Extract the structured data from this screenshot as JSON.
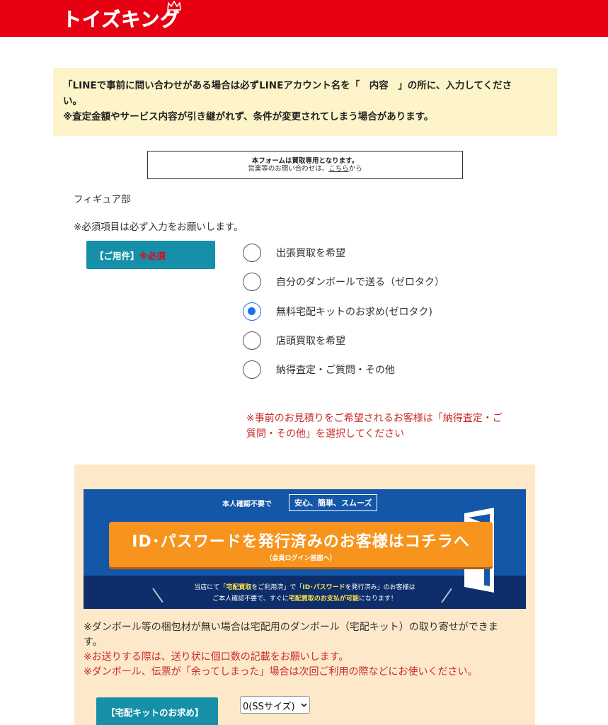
{
  "header": {
    "logo_text": "トイズキング",
    "brand_color": "#e60012"
  },
  "notice": {
    "line1": "「LINEで事前に問い合わせがある場合は必ずLINEアカウント名を「　内容　」の所に、入力してくださ",
    "line2": "い。",
    "line3": "※査定金額やサービス内容が引き継がれず、条件が変更されてしまう場合があります。"
  },
  "form_only": {
    "title": "本フォームは買取専用となります。",
    "sub_prefix": "営業等のお問い合わせは、",
    "link": "こちら",
    "sub_suffix": "から"
  },
  "department": "フィギュア部",
  "required_note": "※必須項目は必ず入力をお願いします。",
  "goyoken": {
    "label": "【ご用件】",
    "required": "※必須",
    "options": [
      {
        "label": "出張買取を希望",
        "checked": false
      },
      {
        "label": "自分のダンボールで送る（ゼロタク）",
        "checked": false
      },
      {
        "label": "無料宅配キットのお求め(ゼロタク)",
        "checked": true
      },
      {
        "label": "店頭買取を希望",
        "checked": false
      },
      {
        "label": "納得査定・ご質問・その他",
        "checked": false
      }
    ]
  },
  "estimate_note": {
    "line1": "※事前のお見積りをご希望されるお客様は「納得査定・ご",
    "line2": "質問・その他」を選択してください"
  },
  "banner": {
    "top_text": "本人確認不要で",
    "tag": "安心、簡単、スムーズ",
    "cta_main": "ID･パスワードを発行済みのお客様はコチラへ",
    "cta_sub": "（会員ログイン画面へ）",
    "desc1_a": "当店にて「",
    "desc1_hl1": "宅配買取",
    "desc1_b": "をご利用済」で「",
    "desc1_hl2": "ID･パスワード",
    "desc1_c": "を発行済み」のお客様は",
    "desc2_a": "ご本人確認不要で、すぐに",
    "desc2_hl": "宅配買取のお支払が可能",
    "desc2_b": "になります！"
  },
  "kit_notes": {
    "line1": "※ダンボール等の梱包材が無い場合は宅配用のダンボール（宅配キット）の取り寄せができま",
    "line2": "す。",
    "line3": "※お送りする際は、送り状に個口数の記載をお願いします。",
    "line4": "※ダンボール、伝票が「余ってしまった」場合は次回ご利用の際などにお使いください。"
  },
  "kit_request": {
    "label": "【宅配キットのお求め】",
    "select_value": "0(SSサイズ)"
  }
}
